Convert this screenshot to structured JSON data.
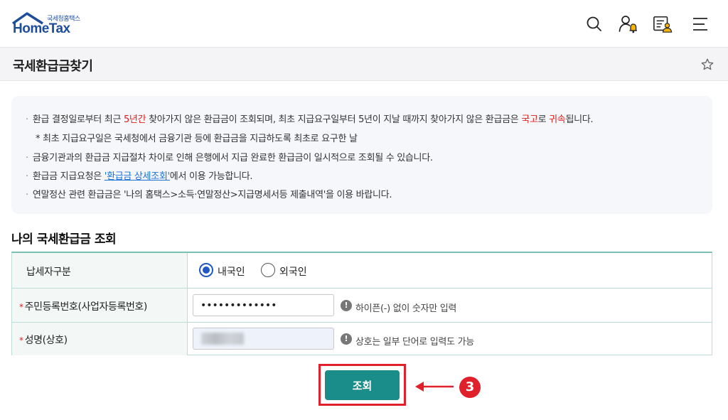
{
  "header": {
    "logo_sub": "국세청홈택스",
    "logo_main": "HomeTax",
    "icons": [
      "search-icon",
      "user-bell-icon",
      "document-user-icon",
      "menu-icon"
    ]
  },
  "page": {
    "title": "국세환급금찾기"
  },
  "notice": {
    "line1_a": "환급 결정일로부터 최근 ",
    "line1_red1": "5년간",
    "line1_b": " 찾아가지 않은 환급금이 조회되며, 최초 지급요구일부터 5년이 지날 때까지 찾아가지 않은 환급금은 ",
    "line1_red2": "국고",
    "line1_c": "로 ",
    "line1_red3": "귀속",
    "line1_d": "됩니다.",
    "line2": "* 최초 지급요구일은 국세청에서 금융기관 등에 환급금을 지급하도록 최초로 요구한 날",
    "line3": "금융기관과의 환급금 지급절차 차이로 인해 은행에서 지급 완료한 환급금이 일시적으로 조회될 수 있습니다.",
    "line4_a": "환급금 지급요청은 ",
    "line4_link": "'환급금 상세조회'",
    "line4_b": "에서 이용 가능합니다.",
    "line5": "연말정산 관련 환급금은 '나의 홈택스>소득·연말정산>지급명세서등 제출내역'을 이용 바랍니다."
  },
  "form": {
    "section_title": "나의 국세환급금 조회",
    "taxpayer_type_label": "납세자구분",
    "radio_domestic": "내국인",
    "radio_foreign": "외국인",
    "selected": "내국인",
    "id_label": "주민등록번호(사업자등록번호)",
    "id_value": "•••••••••••••",
    "id_hint": "하이픈(-) 없이 숫자만 입력",
    "name_label": "성명(상호)",
    "name_hint": "상호는 일부 단어로 입력도 가능",
    "required_mark": "*",
    "hint_mark": "!"
  },
  "submit": {
    "label": "조회"
  },
  "annotation": {
    "step": "3",
    "color": "#e0202a"
  }
}
